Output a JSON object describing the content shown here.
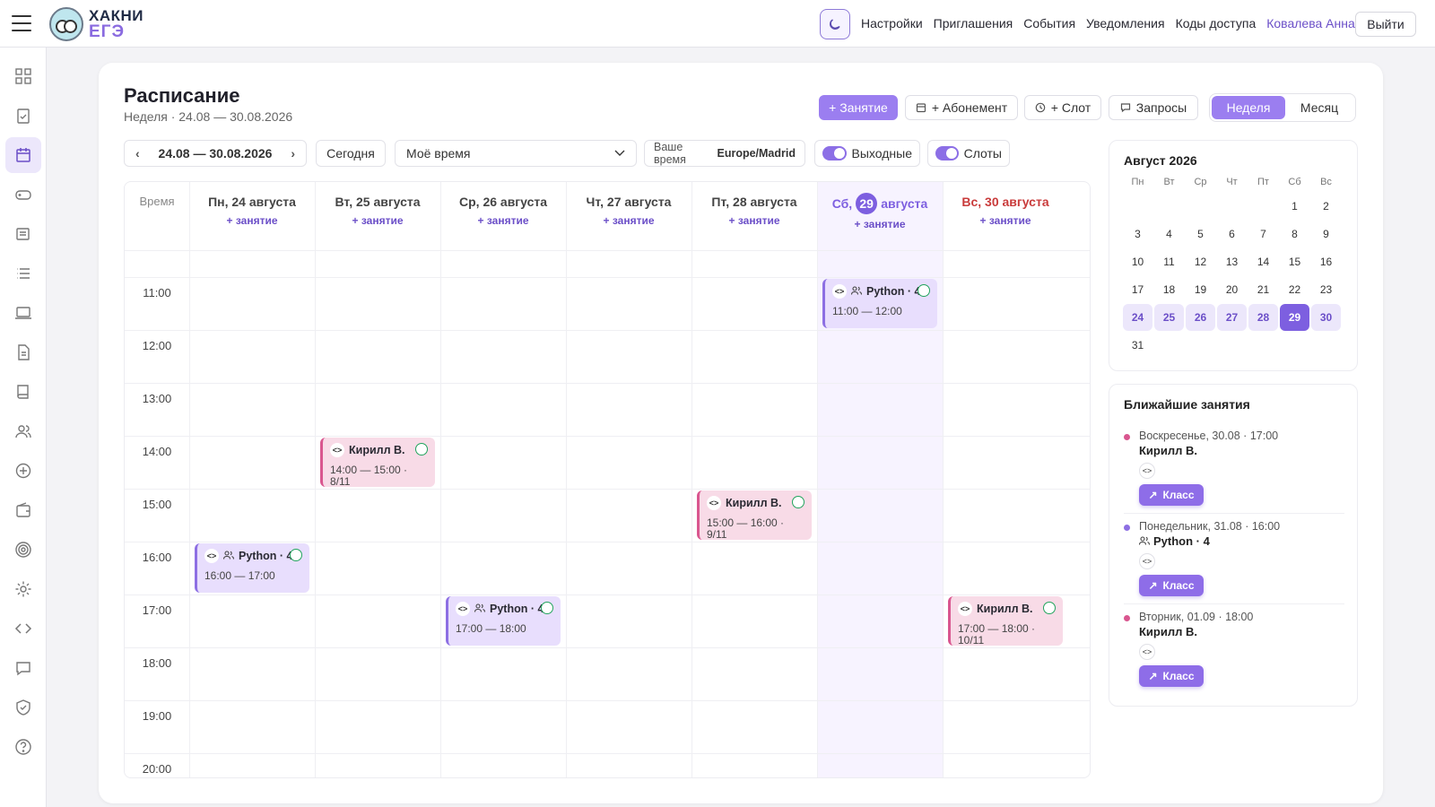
{
  "logo": {
    "line1": "ХАКНИ",
    "line2": "ЕГЭ"
  },
  "topnav": {
    "settings": "Настройки",
    "invites": "Приглашения",
    "events": "События",
    "notifications": "Уведомления",
    "codes": "Коды доступа",
    "user": "Ковалева Анна",
    "logout": "Выйти"
  },
  "header": {
    "title": "Расписание",
    "subtitle": "Неделя · 24.08 — 30.08.2026"
  },
  "toolbar": {
    "lesson": "+ Занятие",
    "subscription": "+ Абонемент",
    "slot": "+ Слот",
    "requests": "Запросы",
    "week": "Неделя",
    "month": "Месяц"
  },
  "controls": {
    "range": "24.08 — 30.08.2026",
    "today": "Сегодня",
    "timeselect": "Моё время",
    "tz_label": "Ваше время",
    "tz_value": "Europe/Madrid",
    "weekends": "Выходные",
    "slots": "Слоты"
  },
  "calendar": {
    "time_label": "Время",
    "add_label": "+ занятие",
    "days": [
      {
        "name": "Пн, 24 августа"
      },
      {
        "name": "Вт, 25 августа"
      },
      {
        "name": "Ср, 26 августа"
      },
      {
        "name": "Чт, 27 августа"
      },
      {
        "name": "Пт, 28 августа"
      },
      {
        "prefix": "Сб,",
        "num": "29",
        "suffix": "августа",
        "today": true
      },
      {
        "name": "Вс, 30 августа",
        "sunday": true
      }
    ],
    "hours": [
      "11:00",
      "12:00",
      "13:00",
      "14:00",
      "15:00",
      "16:00",
      "17:00",
      "18:00",
      "19:00",
      "20:00"
    ],
    "events": [
      {
        "title": "Python · 4",
        "time": "11:00 — 12:00",
        "color": "purple",
        "group": true
      },
      {
        "title": "Кирилл В.",
        "time": "14:00 — 15:00 · 8/11",
        "color": "pink",
        "group": false
      },
      {
        "title": "Кирилл В.",
        "time": "15:00 — 16:00 · 9/11",
        "color": "pink",
        "group": false
      },
      {
        "title": "Python · 4",
        "time": "16:00 — 17:00",
        "color": "purple",
        "group": true
      },
      {
        "title": "Python · 4",
        "time": "17:00 — 18:00",
        "color": "purple",
        "group": true
      },
      {
        "title": "Кирилл В.",
        "time": "17:00 — 18:00 · 10/11",
        "color": "pink",
        "group": false
      }
    ]
  },
  "mini_calendar": {
    "title": "Август 2026",
    "dow": [
      "Пн",
      "Вт",
      "Ср",
      "Чт",
      "Пт",
      "Сб",
      "Вс"
    ],
    "selected": 29,
    "week": [
      24,
      25,
      26,
      27,
      28,
      29,
      30
    ]
  },
  "upcoming": {
    "title": "Ближайшие занятия",
    "button": "Класс",
    "items": [
      {
        "when": "Воскресенье, 30.08 · 17:00",
        "who": "Кирилл В.",
        "color": "#d9568f",
        "group": false
      },
      {
        "when": "Понедельник, 31.08 · 16:00",
        "who": "Python · 4",
        "color": "#8d6fe3",
        "group": true
      },
      {
        "when": "Вторник, 01.09 · 18:00",
        "who": "Кирилл В.",
        "color": "#d9568f",
        "group": false
      }
    ]
  },
  "colors": {
    "accent": "#9b7ef0",
    "today": "#7d5fe0",
    "pink": "#d9568f",
    "sunday": "#c93b3b"
  }
}
